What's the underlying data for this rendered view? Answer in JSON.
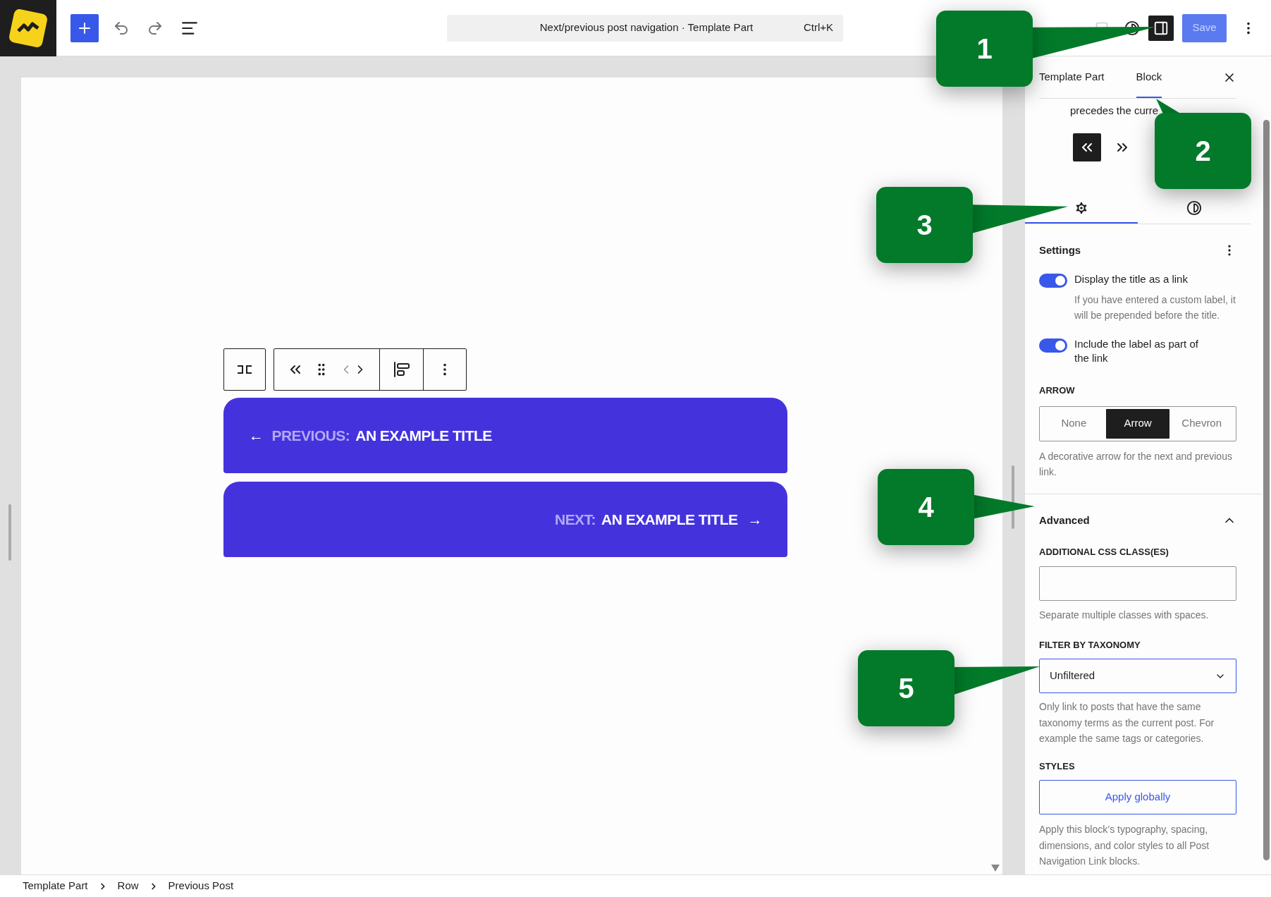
{
  "top_bar": {
    "command": {
      "title": "Next/previous post navigation · Template Part",
      "shortcut": "Ctrl+K"
    },
    "settings_open": true,
    "save": "Save"
  },
  "canvas": {
    "nav_links": [
      {
        "kind": "previous",
        "arrow": "←",
        "label": "PREVIOUS:",
        "title": "AN EXAMPLE TITLE"
      },
      {
        "kind": "next",
        "arrow": "→",
        "label": "NEXT:",
        "title": "AN EXAMPLE TITLE"
      }
    ]
  },
  "sidebar": {
    "tabs": [
      {
        "label": "Template Part",
        "selected": false
      },
      {
        "label": "Block",
        "selected": true
      }
    ],
    "description_fragment": "precedes the curre",
    "direction_buttons": [
      {
        "kind": "previous",
        "selected": true
      },
      {
        "kind": "next",
        "selected": false
      }
    ],
    "panel_tabs": [
      {
        "kind": "settings",
        "selected": true
      },
      {
        "kind": "styles",
        "selected": false
      }
    ],
    "settings": {
      "title": "Settings",
      "toggles": [
        {
          "label": "Display the title as a link",
          "on": true,
          "help": "If you have entered a custom label, it will be prepended before the title."
        },
        {
          "label": "Include the label as part of the link",
          "on": true
        }
      ],
      "arrow": {
        "label": "ARROW",
        "options": [
          {
            "label": "None",
            "selected": false
          },
          {
            "label": "Arrow",
            "selected": true
          },
          {
            "label": "Chevron",
            "selected": false
          }
        ],
        "help": "A decorative arrow for the next and previous link."
      }
    },
    "advanced": {
      "title": "Advanced",
      "expanded": true,
      "css_label": "ADDITIONAL CSS CLASS(ES)",
      "css_help": "Separate multiple classes with spaces.",
      "taxonomy_label": "FILTER BY TAXONOMY",
      "taxonomy_value": "Unfiltered",
      "taxonomy_help": "Only link to posts that have the same taxonomy terms as the current post. For example the same tags or categories.",
      "styles_label": "STYLES",
      "styles_button": "Apply globally",
      "styles_help": "Apply this block’s typography, spacing, dimensions, and color styles to all Post Navigation Link blocks."
    }
  },
  "breadcrumbs": [
    "Template Part",
    "Row",
    "Previous Post"
  ],
  "callouts": [
    {
      "number": "1"
    },
    {
      "number": "2"
    },
    {
      "number": "3"
    },
    {
      "number": "4"
    },
    {
      "number": "5"
    }
  ]
}
